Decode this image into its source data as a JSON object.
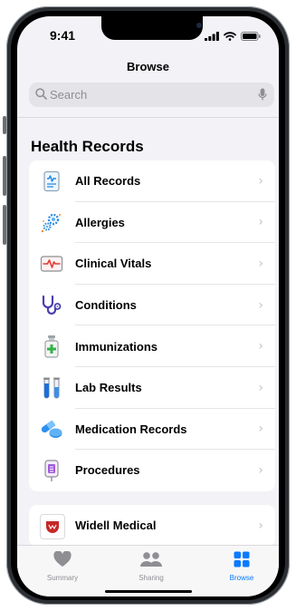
{
  "status_bar": {
    "time": "9:41"
  },
  "nav": {
    "title": "Browse"
  },
  "search": {
    "placeholder": "Search"
  },
  "section": {
    "title": "Health Records"
  },
  "records": [
    {
      "label": "All Records",
      "icon": "document-icon"
    },
    {
      "label": "Allergies",
      "icon": "allergies-icon"
    },
    {
      "label": "Clinical Vitals",
      "icon": "heartbeat-icon"
    },
    {
      "label": "Conditions",
      "icon": "stethoscope-icon"
    },
    {
      "label": "Immunizations",
      "icon": "vaccine-icon"
    },
    {
      "label": "Lab Results",
      "icon": "test-tubes-icon"
    },
    {
      "label": "Medication Records",
      "icon": "pills-icon"
    },
    {
      "label": "Procedures",
      "icon": "iv-bag-icon"
    }
  ],
  "providers": [
    {
      "label": "Widell Medical",
      "icon": "provider-logo-icon"
    }
  ],
  "tabbar": {
    "summary": "Summary",
    "sharing": "Sharing",
    "browse": "Browse"
  },
  "colors": {
    "accent": "#0a7aff",
    "background": "#f2f2f7"
  }
}
